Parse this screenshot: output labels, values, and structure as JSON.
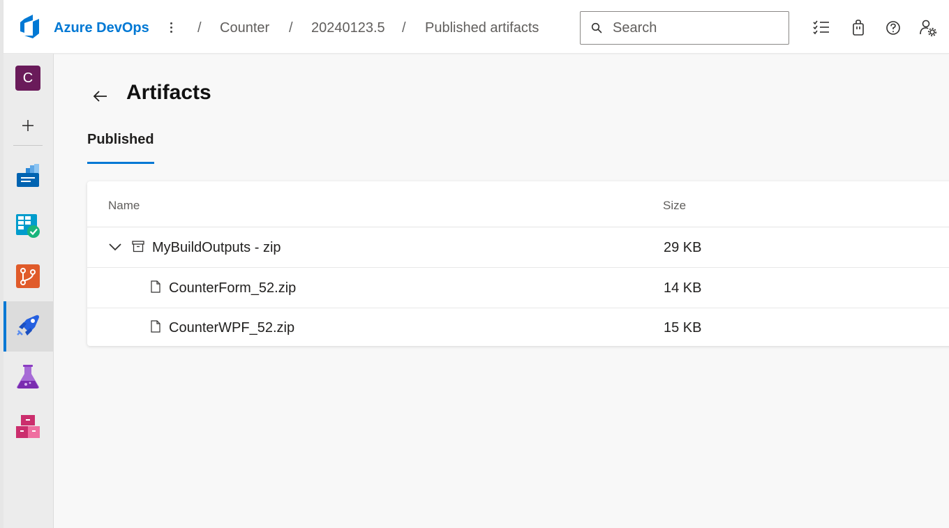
{
  "header": {
    "brand": "Azure DevOps",
    "breadcrumb": [
      "Counter",
      "20240123.5",
      "Published artifacts"
    ],
    "separator": "/",
    "search_placeholder": "Search",
    "icons": [
      "more-vertical-icon",
      "task-list-icon",
      "shopping-bag-icon",
      "help-icon",
      "user-settings-icon"
    ]
  },
  "sidebar": {
    "org_initial": "C",
    "items": [
      {
        "name": "overview",
        "icon": "overview-icon",
        "color": "#0078d4"
      },
      {
        "name": "boards",
        "icon": "boards-icon",
        "color": "#009ccc"
      },
      {
        "name": "repos",
        "icon": "repos-icon",
        "color": "#e05b2a"
      },
      {
        "name": "pipelines",
        "icon": "pipelines-icon",
        "color": "#2560e0",
        "active": true
      },
      {
        "name": "test-plans",
        "icon": "test-plans-icon",
        "color": "#8b3cc2"
      },
      {
        "name": "artifacts",
        "icon": "artifacts-icon",
        "color": "#cb2e6d"
      }
    ]
  },
  "page": {
    "title": "Artifacts",
    "tab": "Published"
  },
  "table": {
    "columns": [
      "Name",
      "Size"
    ],
    "rows": [
      {
        "name": "MyBuildOutputs - zip",
        "size": "29 KB",
        "type": "folder",
        "expanded": true
      },
      {
        "name": "CounterForm_52.zip",
        "size": "14 KB",
        "type": "file"
      },
      {
        "name": "CounterWPF_52.zip",
        "size": "15 KB",
        "type": "file"
      }
    ]
  },
  "colors": {
    "accent": "#0078d4",
    "org_avatar": "#6a1b5a"
  }
}
